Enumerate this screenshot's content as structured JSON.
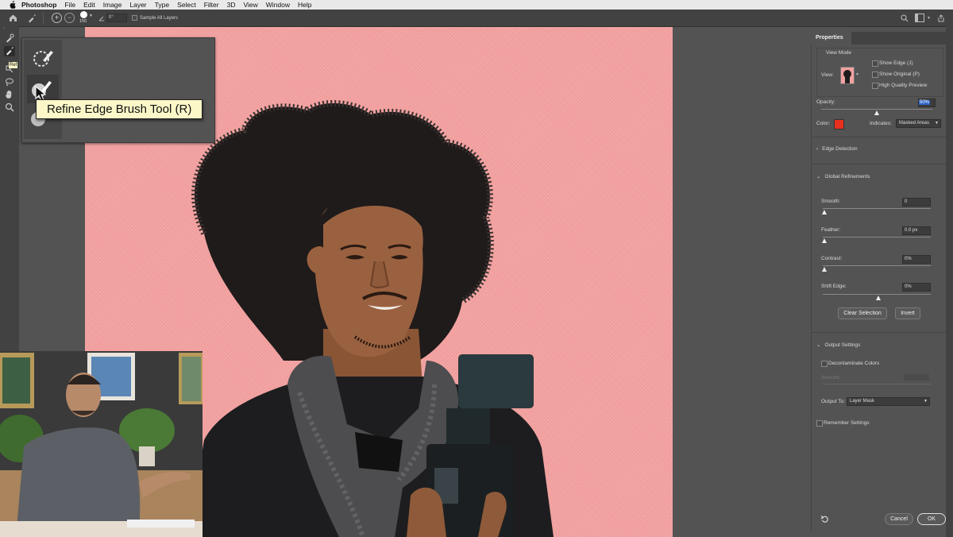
{
  "menubar": {
    "app_name": "Photoshop",
    "items": [
      "File",
      "Edit",
      "Image",
      "Layer",
      "Type",
      "Select",
      "Filter",
      "3D",
      "View",
      "Window",
      "Help"
    ]
  },
  "options_bar": {
    "brush_size": "150",
    "angle": "0°",
    "sample_all_layers_label": "Sample All Layers"
  },
  "tools": [
    "quick-selection",
    "refine-edge-brush",
    "brush",
    "object-selection",
    "lasso",
    "hand",
    "zoom"
  ],
  "flyout": {
    "tooltip": "Refine Edge Brush Tool (R)",
    "mini_tooltip": "Ref"
  },
  "properties": {
    "tab_label": "Properties",
    "view_mode": {
      "title": "View Mode",
      "view_label": "View:",
      "show_edge": "Show Edge (J)",
      "show_original": "Show Original (P)",
      "high_quality_preview": "High Quality Preview"
    },
    "opacity_label": "Opacity:",
    "opacity_value": "50%",
    "opacity_fraction": 0.5,
    "color_label": "Color:",
    "color_value": "#e8301e",
    "indicates_label": "Indicates:",
    "indicates_value": "Masked Areas",
    "edge_detection": "Edge Detection",
    "global_refinements": "Global Refinements",
    "smooth_label": "Smooth:",
    "smooth_value": "0",
    "feather_label": "Feather:",
    "feather_value": "0.0 px",
    "contrast_label": "Contrast:",
    "contrast_value": "0%",
    "shift_edge_label": "Shift Edge:",
    "shift_edge_value": "0%",
    "clear_selection": "Clear Selection",
    "invert": "Invert",
    "output_settings": "Output Settings",
    "decontaminate_colors": "Decontaminate Colors",
    "amount_label": "Amount:",
    "output_to_label": "Output To:",
    "output_to_value": "Layer Mask",
    "remember_settings": "Remember Settings",
    "cancel": "Cancel",
    "ok": "OK"
  },
  "colors": {
    "overlay_pink": "#f2a1a0",
    "ui_panel": "#535353",
    "ui_dark": "#424242",
    "tooltip_bg": "#fbf7c8",
    "color_swatch": "#e8301e"
  }
}
